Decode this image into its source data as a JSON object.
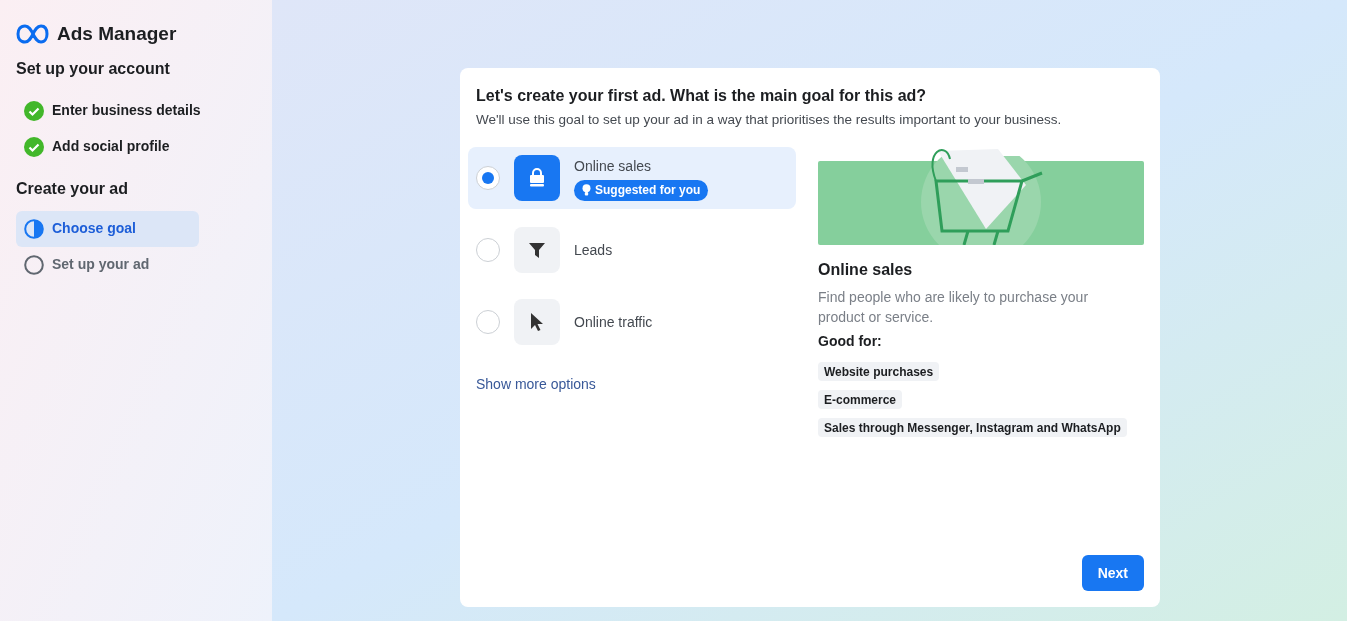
{
  "sidebar": {
    "app_title": "Ads Manager",
    "sections": [
      {
        "title": "Set up your account",
        "steps": [
          {
            "label": "Enter business details",
            "kind": "done",
            "selected": false
          },
          {
            "label": "Add social profile",
            "kind": "done",
            "selected": false
          }
        ]
      },
      {
        "title": "Create your ad",
        "steps": [
          {
            "label": "Choose goal",
            "kind": "current",
            "selected": true
          },
          {
            "label": "Set up your ad",
            "kind": "todo",
            "selected": false
          }
        ]
      }
    ]
  },
  "card": {
    "title": "Let's create your first ad. What is the main goal for this ad?",
    "subtitle": "We'll use this goal to set up your ad in a way that prioritises the results important to your business.",
    "options": [
      {
        "label": "Online sales",
        "kind": "bag",
        "selected": true,
        "badge": "Suggested for you"
      },
      {
        "label": "Leads",
        "kind": "funnel",
        "selected": false
      },
      {
        "label": "Online traffic",
        "kind": "cursor",
        "selected": false
      }
    ],
    "more_link": "Show more options",
    "detail": {
      "title": "Online sales",
      "description": "Find people who are likely to purchase your product or service.",
      "good_for_label": "Good for:",
      "tags": [
        "Website purchases",
        "E-commerce",
        "Sales through Messenger, Instagram and WhatsApp"
      ]
    },
    "next_button": "Next"
  }
}
